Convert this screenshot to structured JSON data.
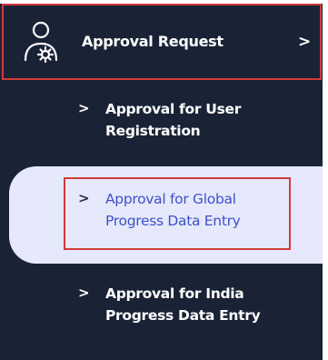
{
  "sidebar": {
    "parent": {
      "icon": "user-gear-icon",
      "label": "Approval Request",
      "chevron": ">"
    },
    "items": [
      {
        "chevron": ">",
        "line1": "Approval for User",
        "line2": "Registration"
      },
      {
        "chevron": ">",
        "line1": "Approval for Global",
        "line2": "Progress Data Entry",
        "active": true
      },
      {
        "chevron": ">",
        "line1": "Approval for India",
        "line2": "Progress Data Entry"
      }
    ]
  },
  "colors": {
    "sidebar_bg": "#1a2336",
    "active_bg": "#e6e9fb",
    "active_text": "#3f51c8",
    "highlight_border": "#d23a3a"
  }
}
